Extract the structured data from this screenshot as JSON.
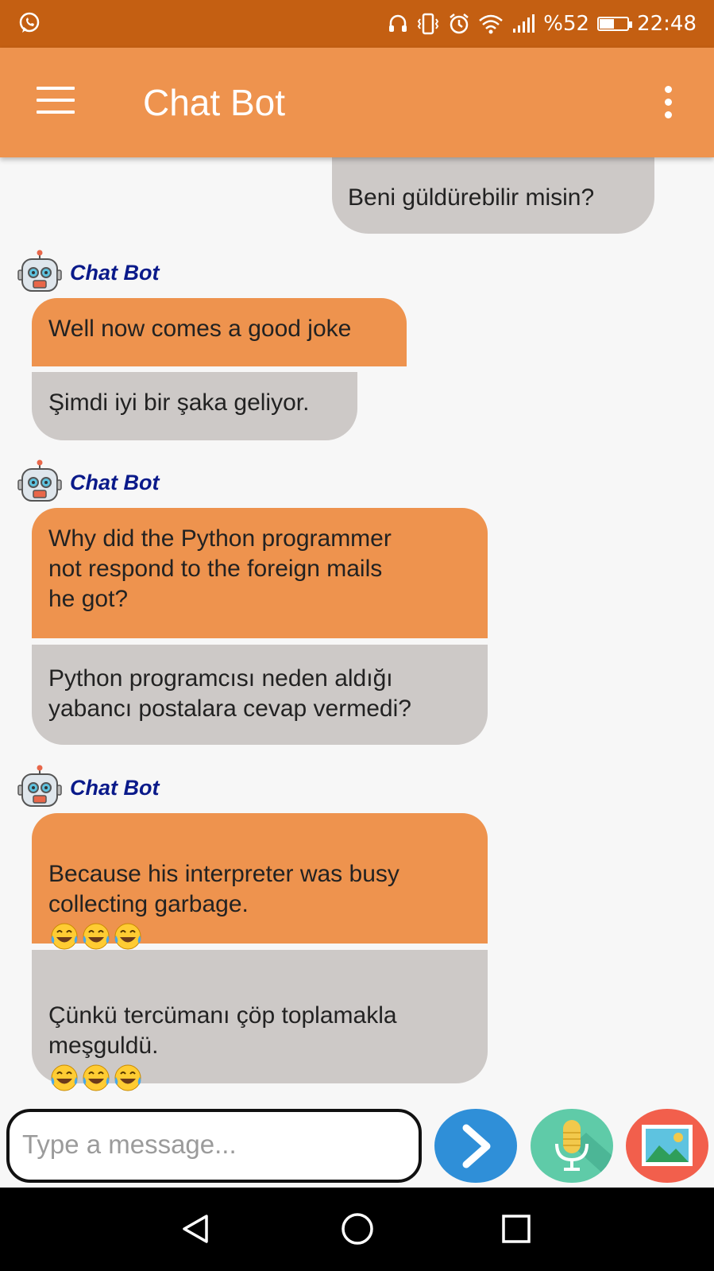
{
  "status_bar": {
    "battery_text": "%52",
    "battery_level": 0.52,
    "time": "22:48",
    "icons": [
      "whatsapp-icon",
      "headphones-icon",
      "vibrate-icon",
      "alarm-icon",
      "wifi-icon",
      "signal-icon",
      "battery-icon"
    ]
  },
  "app_bar": {
    "title": "Chat Bot",
    "menu_icon": "hamburger-menu-icon",
    "overflow_icon": "more-vert-icon"
  },
  "messages": {
    "user_1": "Beni güldürebilir misin?",
    "bot_1": {
      "name": "Chat Bot",
      "english": "Well now comes a good joke",
      "turkish": "Şimdi iyi bir şaka geliyor."
    },
    "bot_2": {
      "name": "Chat Bot",
      "english": "Why did the Python programmer\nnot respond to the foreign mails\nhe got?",
      "turkish": "Python programcısı neden aldığı\nyabancı postalara cevap vermedi?"
    },
    "bot_3": {
      "name": "Chat Bot",
      "english": "Because his interpreter was busy\ncollecting garbage.",
      "turkish": "Çünkü tercümanı çöp toplamakla\nmeşguldü.",
      "emoji_count": 3
    }
  },
  "input": {
    "placeholder": "Type a message...",
    "value": ""
  },
  "buttons": {
    "send_icon": "send-chevron-icon",
    "mic_icon": "microphone-icon",
    "image_icon": "image-picture-icon"
  },
  "colors": {
    "status_bar": "#c45f12",
    "app_bar": "#ee934e",
    "bot_bubble": "#ee934e",
    "translation_bubble": "#cdc9c7",
    "bot_name": "#0a1a8a",
    "send": "#2f8fd8",
    "mic": "#5fcba8",
    "image": "#f25f4c"
  },
  "nav_bar": {
    "items": [
      "back-icon",
      "home-icon",
      "recents-icon"
    ]
  }
}
